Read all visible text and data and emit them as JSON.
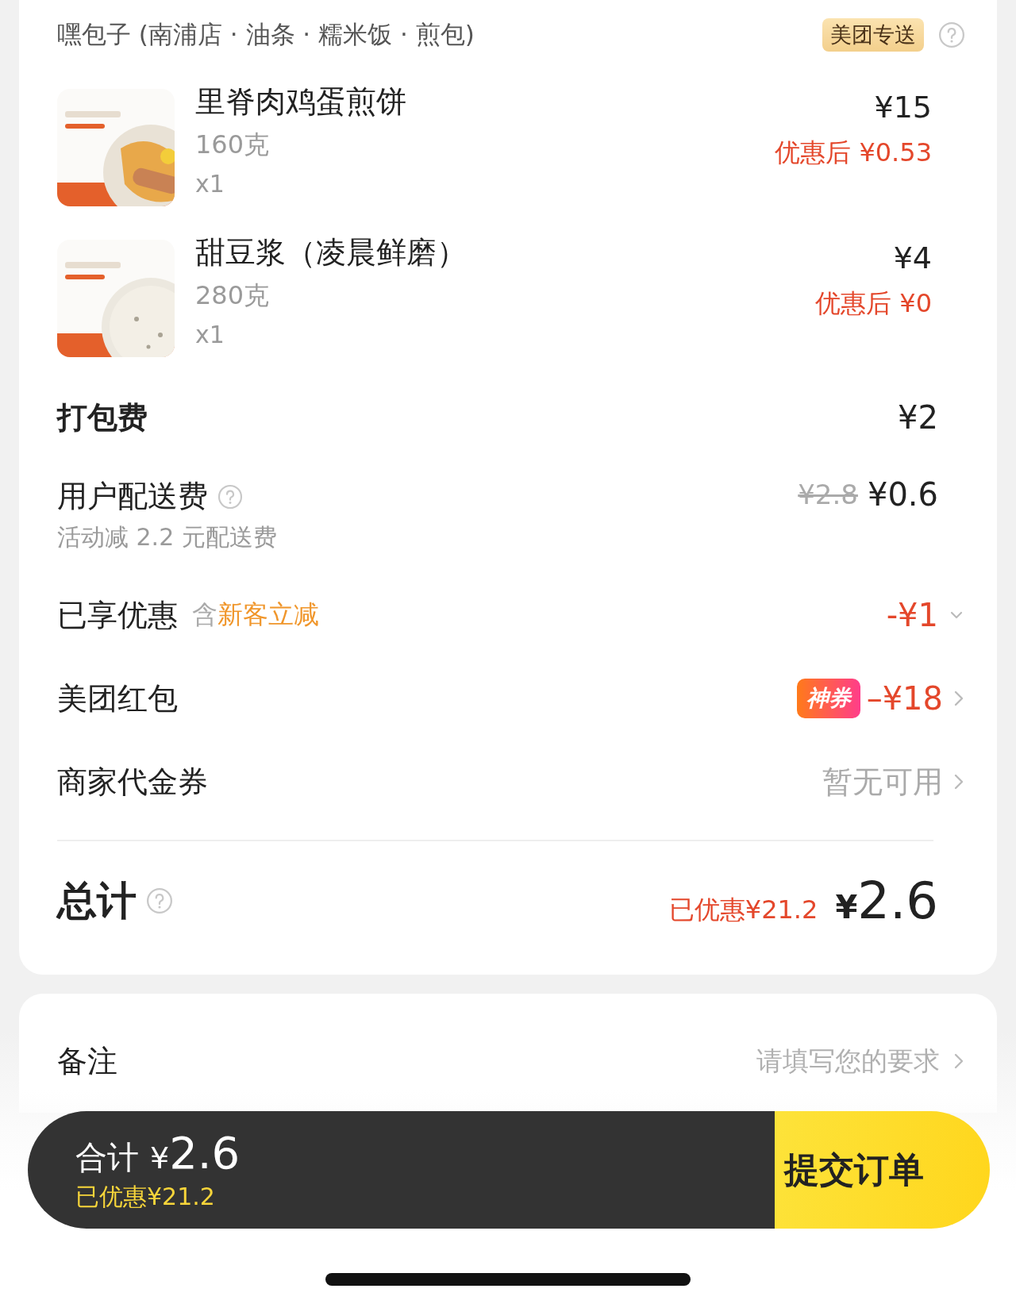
{
  "store": {
    "name": "嘿包子 (南浦店 · 油条 · 糯米饭 · 煎包)",
    "badge": "美团专送"
  },
  "items": [
    {
      "name": "里脊肉鸡蛋煎饼",
      "weight": "160克",
      "qty": "x1",
      "price": "¥15",
      "discounted": "优惠后 ¥0.53",
      "kind": "pancake"
    },
    {
      "name": "甜豆浆（凌晨鲜磨）",
      "weight": "280克",
      "qty": "x1",
      "price": "¥4",
      "discounted": "优惠后 ¥0",
      "kind": "soymilk"
    }
  ],
  "fees": [
    {
      "kind": "plain",
      "label": "打包费",
      "value": "¥2"
    },
    {
      "kind": "delivery",
      "label": "用户配送费",
      "note": "活动减 2.2 元配送费",
      "original": "¥2.8",
      "value": "¥0.6"
    },
    {
      "kind": "discount",
      "label": "已享优惠",
      "prefix": "含",
      "highlight": "新客立减",
      "value": "-¥1",
      "expanded": false
    },
    {
      "kind": "coupon",
      "label": "美团红包",
      "tag": "神券",
      "value": "–¥18"
    },
    {
      "kind": "voucher",
      "label": "商家代金券",
      "value": "暂无可用"
    }
  ],
  "total": {
    "label": "总计",
    "saved": "已优惠¥21.2",
    "currency": "¥",
    "amount": "2.6"
  },
  "note": {
    "label": "备注",
    "placeholder": "请填写您的要求"
  },
  "checkout": {
    "label": "合计",
    "currency": "¥",
    "amount": "2.6",
    "saved": "已优惠¥21.2",
    "submit": "提交订单"
  }
}
